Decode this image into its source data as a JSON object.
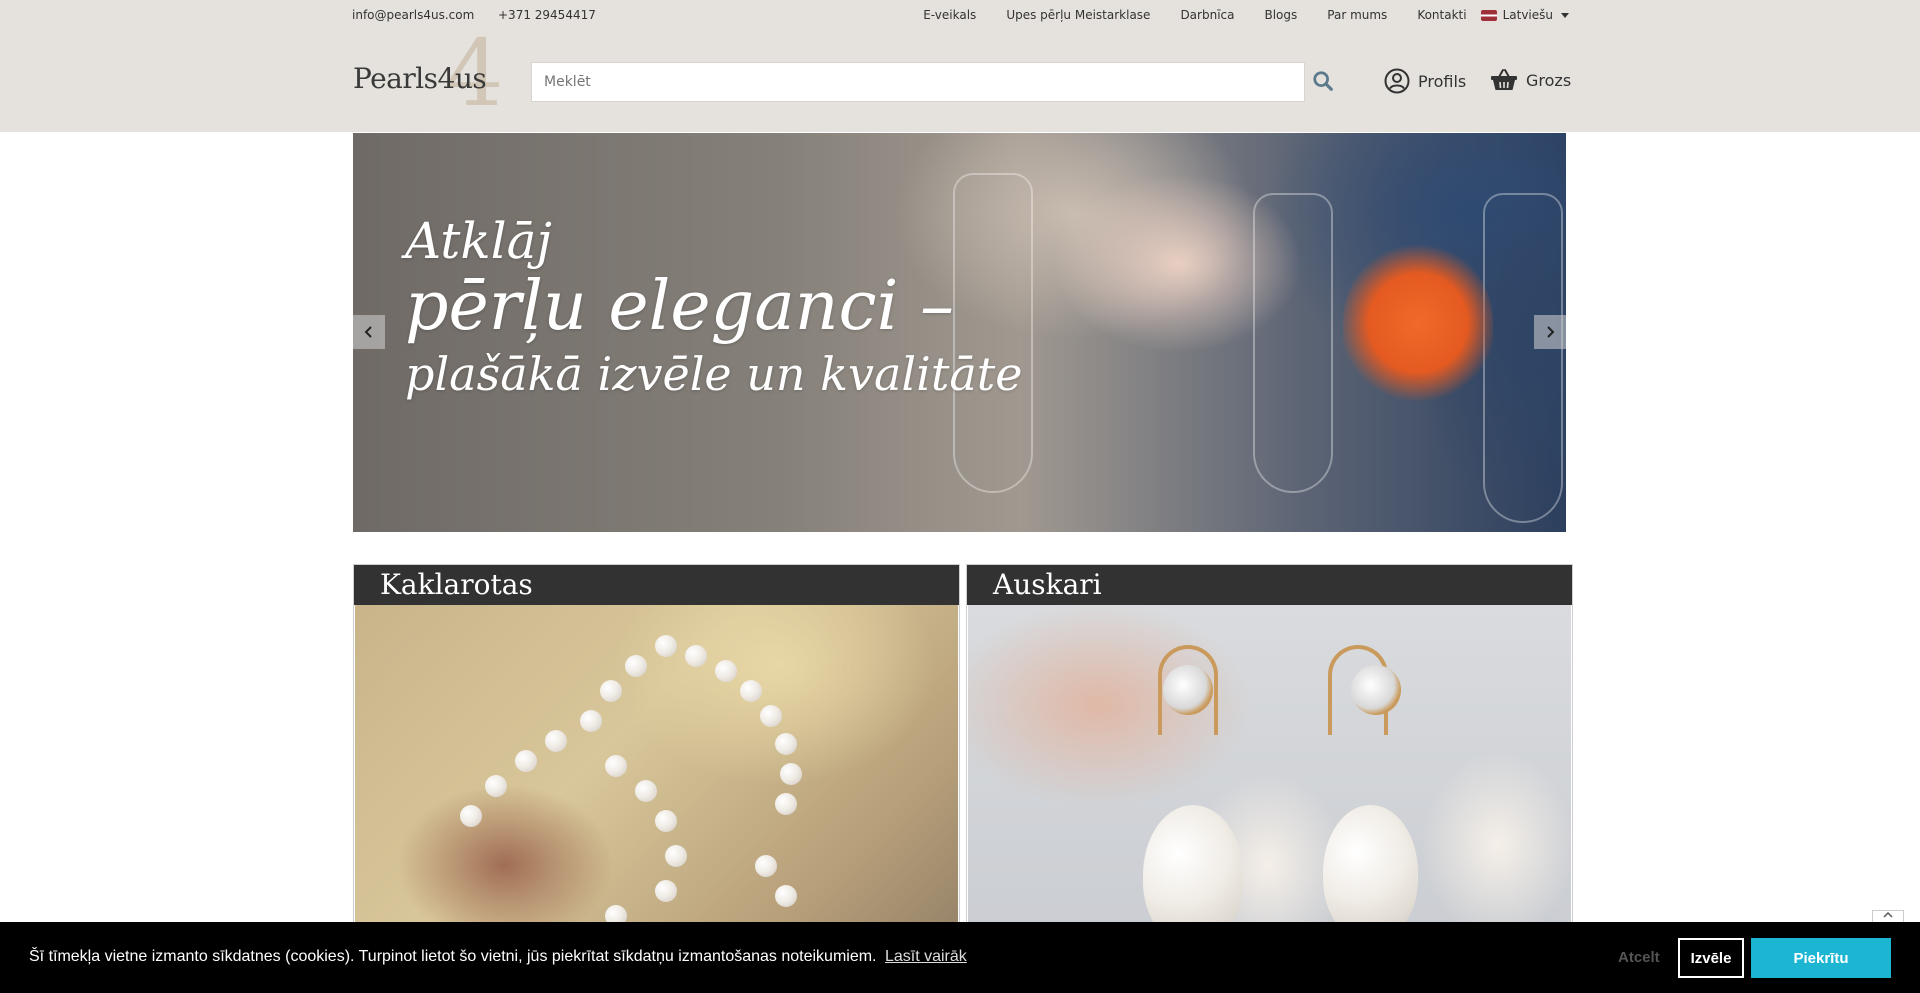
{
  "header": {
    "email": "info@pearls4us.com",
    "phone": "+371 29454417",
    "nav": [
      "E-veikals",
      "Upes pērļu Meistarklase",
      "Darbnīca",
      "Blogs",
      "Par mums",
      "Kontakti"
    ],
    "language": "Latviešu",
    "logo_text": "Pearls4us",
    "logo_mark": "4",
    "search_placeholder": "Meklēt",
    "profile_label": "Profils",
    "cart_label": "Grozs"
  },
  "hero": {
    "line1": "Atklāj",
    "line2": "pērļu eleganci –",
    "line3": "plašākā izvēle un kvalitāte"
  },
  "categories": [
    {
      "title": "Kaklarotas"
    },
    {
      "title": "Auskari"
    }
  ],
  "cookie": {
    "message": "Šī tīmekļa vietne izmanto sīkdatnes (cookies). Turpinot lietot šo vietni, jūs piekrītat sīkdatņu izmantošanas noteikumiem.",
    "learn_more": "Lasīt vairāk",
    "deny": "Atcelt",
    "choose": "Izvēle",
    "accept": "Piekrītu"
  },
  "colors": {
    "header_bg": "#e5e2dd",
    "category_title_bg": "#333232",
    "accept_button": "#1cb6d3",
    "cookie_bar_bg": "#000000"
  }
}
